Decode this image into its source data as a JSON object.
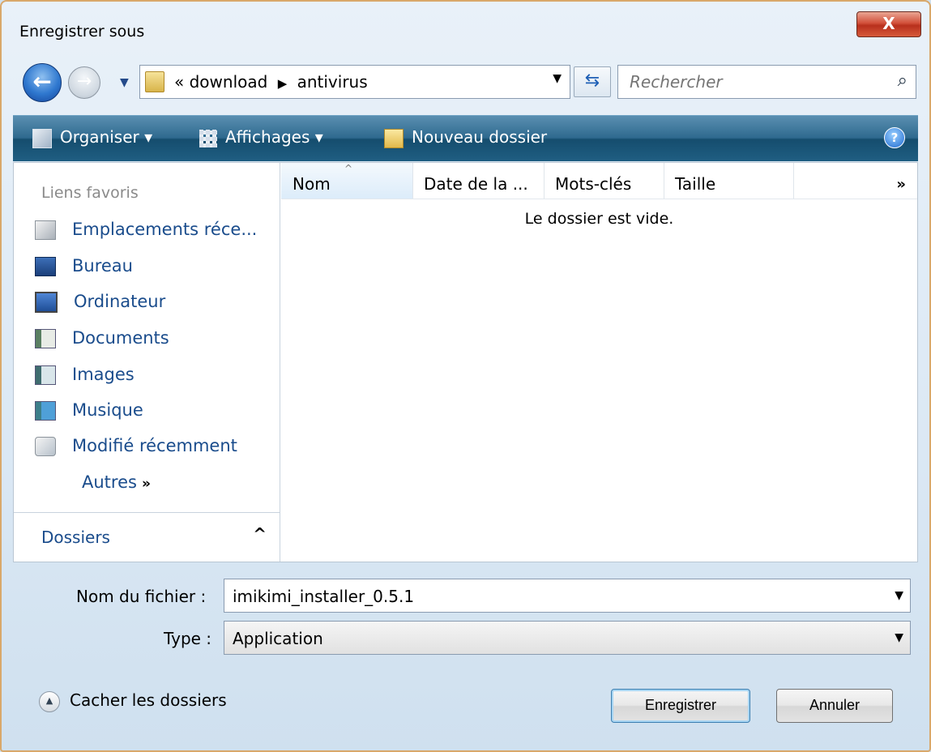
{
  "window": {
    "title": "Enregistrer sous",
    "close_glyph": "X"
  },
  "nav": {
    "breadcrumbs": [
      "download",
      "antivirus"
    ],
    "overflow_glyph": "«",
    "search_placeholder": "Rechercher"
  },
  "toolbar": {
    "organize": "Organiser",
    "views": "Affichages",
    "new_folder": "Nouveau dossier",
    "help": "?"
  },
  "sidebar": {
    "favorites_title": "Liens favoris",
    "items": [
      {
        "label": "Emplacements réce...",
        "icon": "recent-places-icon"
      },
      {
        "label": "Bureau",
        "icon": "desktop-icon"
      },
      {
        "label": "Ordinateur",
        "icon": "computer-icon"
      },
      {
        "label": "Documents",
        "icon": "documents-icon"
      },
      {
        "label": "Images",
        "icon": "pictures-icon"
      },
      {
        "label": "Musique",
        "icon": "music-icon"
      },
      {
        "label": "Modifié récemment",
        "icon": "recently-changed-icon"
      }
    ],
    "more": "Autres",
    "more_glyph": "»",
    "folders": "Dossiers"
  },
  "filelist": {
    "columns": [
      "Nom",
      "Date de la ...",
      "Mots-clés",
      "Taille"
    ],
    "more_glyph": "»",
    "empty_message": "Le dossier est vide."
  },
  "form": {
    "filename_label": "Nom du fichier :",
    "filename_value": "imikimi_installer_0.5.1",
    "type_label": "Type :",
    "type_value": "Application"
  },
  "footer": {
    "hide_folders": "Cacher les dossiers",
    "save": "Enregistrer",
    "cancel": "Annuler"
  },
  "colors": {
    "toolbar": "#1f5e82",
    "link": "#1a4c8c",
    "close": "#c43c24"
  }
}
